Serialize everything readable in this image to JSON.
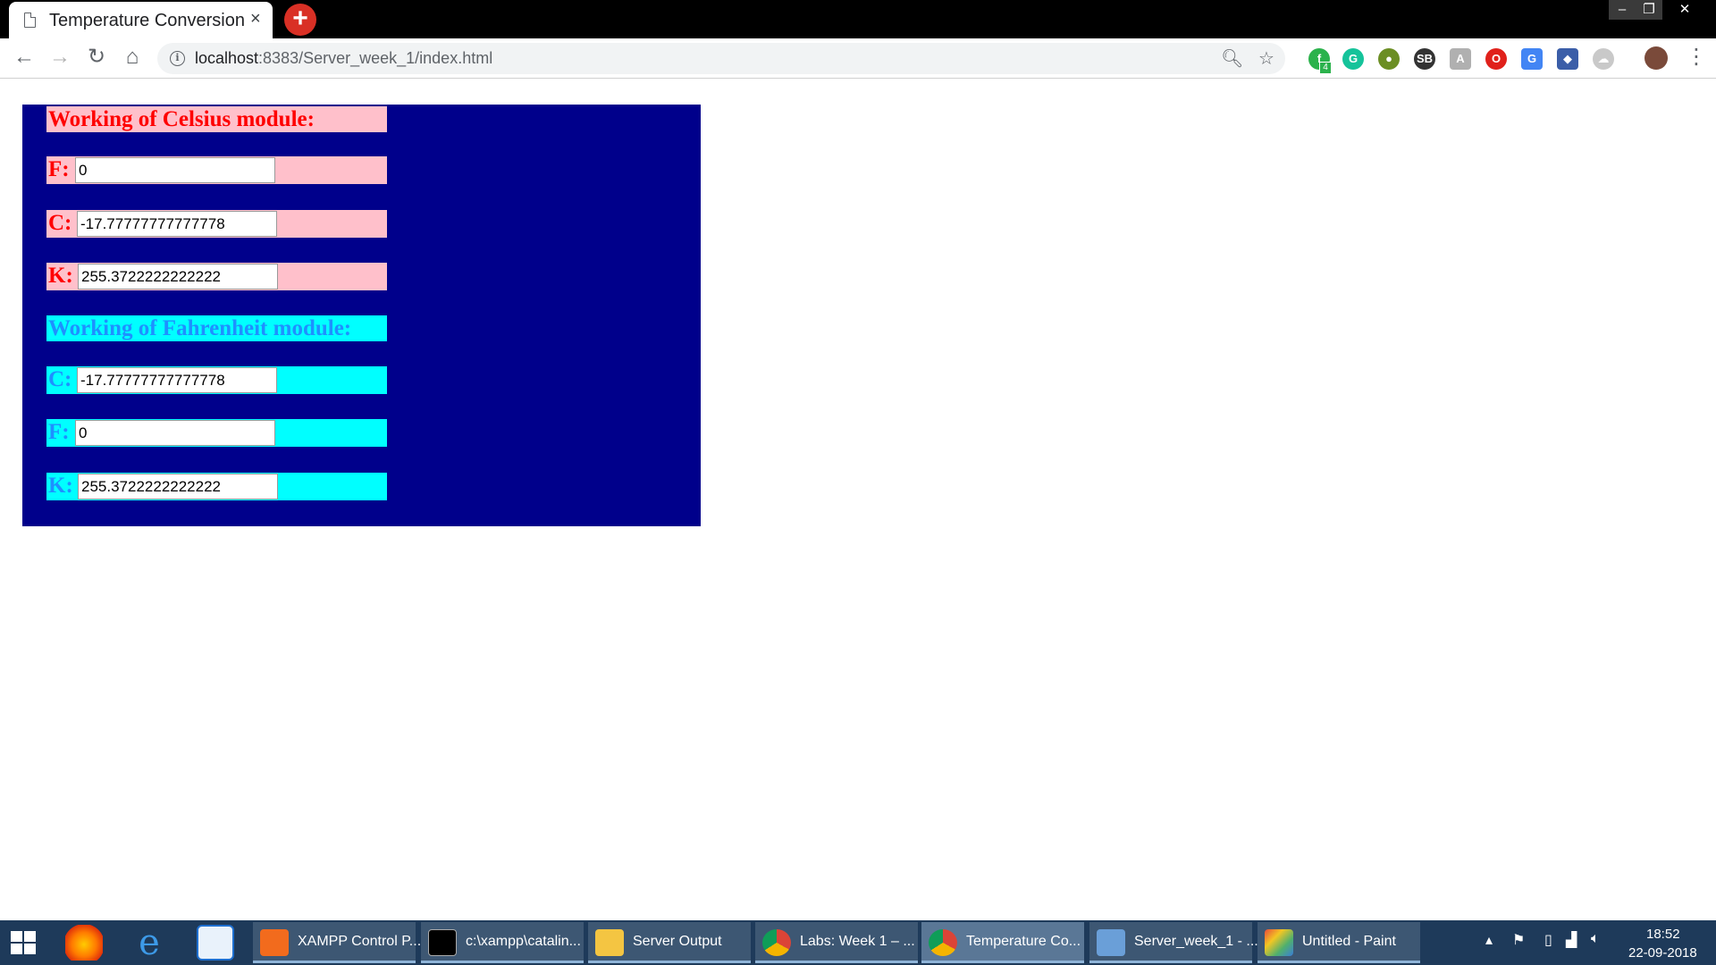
{
  "browser": {
    "tab_title": "Temperature Conversion",
    "tab_close": "×",
    "new_tab": "+",
    "url_host": "localhost",
    "url_rest": ":8383/Server_week_1/index.html",
    "extension_badge": "4",
    "extensions": [
      "feedly-icon",
      "grammarly-icon",
      "pin-icon",
      "sb-icon",
      "reader-icon",
      "opera-icon",
      "translate-icon",
      "cube-icon",
      "cloud-icon"
    ]
  },
  "celsius_module": {
    "heading": "Working of Celsius module:",
    "f_label": "F:",
    "f_value": "0",
    "c_label": "C:",
    "c_value": "-17.77777777777778",
    "k_label": "K:",
    "k_value": "255.3722222222222"
  },
  "fahrenheit_module": {
    "heading": "Working of Fahrenheit module:",
    "c_label": "C:",
    "c_value": "-17.77777777777778",
    "f_label": "F:",
    "f_value": "0",
    "k_label": "K:",
    "k_value": "255.3722222222222"
  },
  "colors": {
    "panel_bg": "#00008b",
    "celsius_bg": "#ffc0cb",
    "celsius_text": "#ff0000",
    "fahrenheit_bg": "#00ffff",
    "fahrenheit_text": "#1e90ff"
  },
  "taskbar": {
    "tasks": [
      "XAMPP Control P...",
      "c:\\xampp\\catalin...",
      "Server Output",
      "Labs: Week 1 – ...",
      "Temperature Co...",
      "Server_week_1 - ...",
      "Untitled - Paint"
    ],
    "time": "18:52",
    "date": "22-09-2018"
  }
}
